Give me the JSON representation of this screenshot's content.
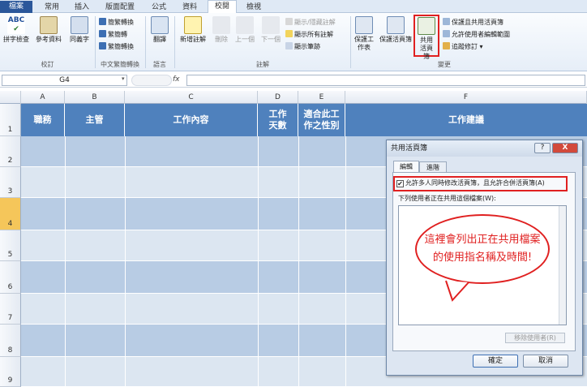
{
  "ribbon_tabs": [
    "檔案",
    "常用",
    "插入",
    "版面配置",
    "公式",
    "資料",
    "校閱",
    "檢視"
  ],
  "groups": {
    "proofing": {
      "label": "校訂",
      "buttons": [
        "拼字檢查",
        "參考資料",
        "同義字"
      ]
    },
    "chinese": {
      "label": "中文繁簡轉換",
      "items": [
        "簡繁轉換",
        "繁簡轉",
        "繁簡轉換"
      ]
    },
    "language": {
      "label": "語言",
      "button": "翻譯"
    },
    "comments": {
      "label": "註解",
      "buttons": [
        "新增註解",
        "刪除",
        "上一個",
        "下一個"
      ],
      "small": [
        "顯示/隱藏註解",
        "顯示所有註解",
        "顯示筆跡"
      ]
    },
    "changes": {
      "label": "變更",
      "buttons": [
        "保護工作表",
        "保護活頁簿",
        "共用活頁簿"
      ],
      "small": [
        "保護且共用活頁簿",
        "允許使用者編輯範圍",
        "追蹤修訂 ▾"
      ]
    }
  },
  "formula_bar": {
    "name_box": "G4",
    "fx": "fx",
    "value": ""
  },
  "columns": [
    "A",
    "B",
    "C",
    "D",
    "E",
    "F"
  ],
  "rows": [
    "1",
    "2",
    "3",
    "4",
    "5",
    "6",
    "7",
    "8",
    "9"
  ],
  "header_row": [
    "職務",
    "主管",
    "工作內容",
    "工作天數",
    "適合此工作之性別",
    "工作建議"
  ],
  "dialog": {
    "title": "共用活頁簿",
    "help": "?",
    "close": "X",
    "tabs": [
      "編輯",
      "進階"
    ],
    "checkbox_label": "允許多人同時修改活頁簿，且允許合併活頁簿(A)",
    "checked": true,
    "list_label": "下列使用者正在共用這個檔案(W):",
    "annotation": "這裡會列出正在共用檔案的使用指名稱及時間!",
    "remove_button": "移除使用者(R)",
    "ok": "確定",
    "cancel": "取消"
  },
  "colors": {
    "header_fill": "#4f81bd",
    "band_dark": "#b8cce4",
    "band_light": "#dce6f1",
    "highlight": "#e02020"
  }
}
